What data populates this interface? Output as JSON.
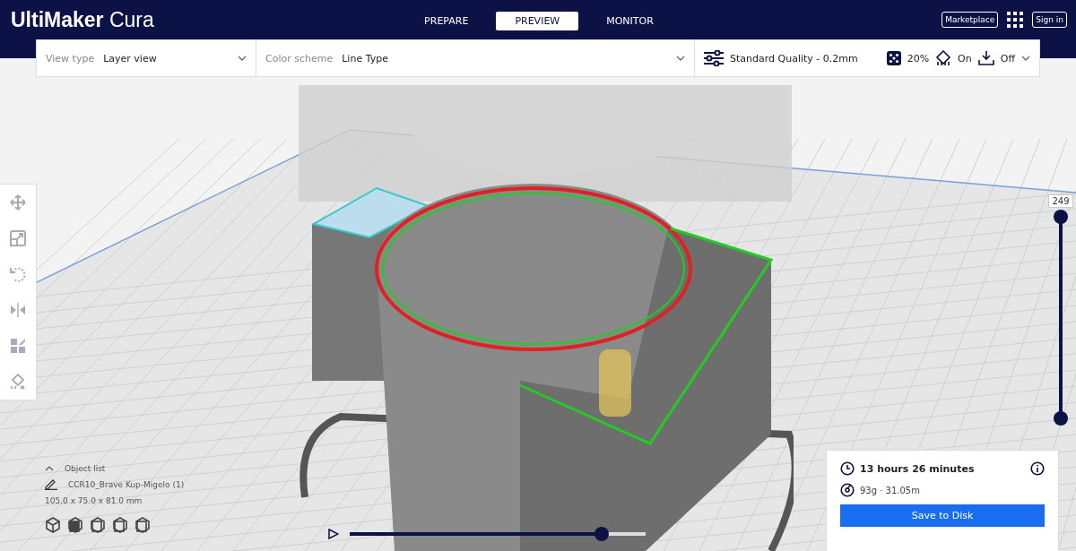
{
  "app": {
    "logo": "UltiMaker",
    "logo_suffix": "Cura"
  },
  "stages": [
    {
      "label": "PREPARE",
      "selected": false
    },
    {
      "label": "PREVIEW",
      "selected": true
    },
    {
      "label": "MONITOR",
      "selected": false
    }
  ],
  "header_buttons": [
    "Marketplace",
    "Sign in"
  ],
  "view_bar": {
    "view_type_label": "View type",
    "view_type": "Layer view",
    "color_scheme_label": "Color scheme",
    "color_scheme": "Line Type"
  },
  "print_settings": {
    "profile": "Standard Quality - 0.2mm",
    "infill": "20%",
    "support": "On",
    "adhesion": "Off"
  },
  "layer_slider": {
    "reading": "249",
    "level": 1
  },
  "path_slider": {
    "level": 0.85
  },
  "object_list": {
    "title": "Object list",
    "object": "CCR10_Brave Kup-Migelo (1)",
    "dimensions": "105.0 x 75.0 x 81.0 mm"
  },
  "print_info": {
    "time": "13 hours 26 minutes",
    "material": "93g · 31.05m",
    "button": "Save to Disk"
  }
}
